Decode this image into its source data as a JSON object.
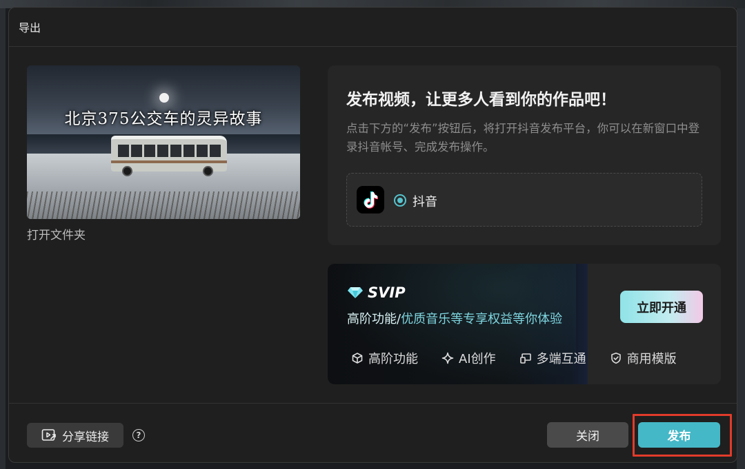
{
  "dialog": {
    "title": "导出",
    "open_folder": "打开文件夹"
  },
  "thumbnail": {
    "caption": "北京375公交车的灵异故事"
  },
  "publish": {
    "title": "发布视频，让更多人看到你的作品吧！",
    "description": "点击下方的“发布”按钮后，将打开抖音发布平台，你可以在新窗口中登录抖音帐号、完成发布操作。",
    "platform": {
      "icon": "tiktok-logo-icon",
      "label": "抖音",
      "selected": true
    }
  },
  "svip": {
    "brand": "SVIP",
    "desc_prefix": "高阶功能/",
    "desc_main": "优质音乐等专享权益等你体验",
    "activate_label": "立即开通",
    "features": [
      {
        "icon": "cube-icon",
        "label": "高阶功能"
      },
      {
        "icon": "sparkle-icon",
        "label": "AI创作"
      },
      {
        "icon": "multi-device-icon",
        "label": "多端互通"
      },
      {
        "icon": "shield-check-icon",
        "label": "商用模版"
      }
    ]
  },
  "footer": {
    "share_label": "分享链接",
    "help_symbol": "?",
    "close_label": "关闭",
    "publish_label": "发布"
  },
  "colors": {
    "accent": "#45b8c7",
    "highlight": "#e23b2a",
    "dialog_bg": "#1f1f1f"
  }
}
